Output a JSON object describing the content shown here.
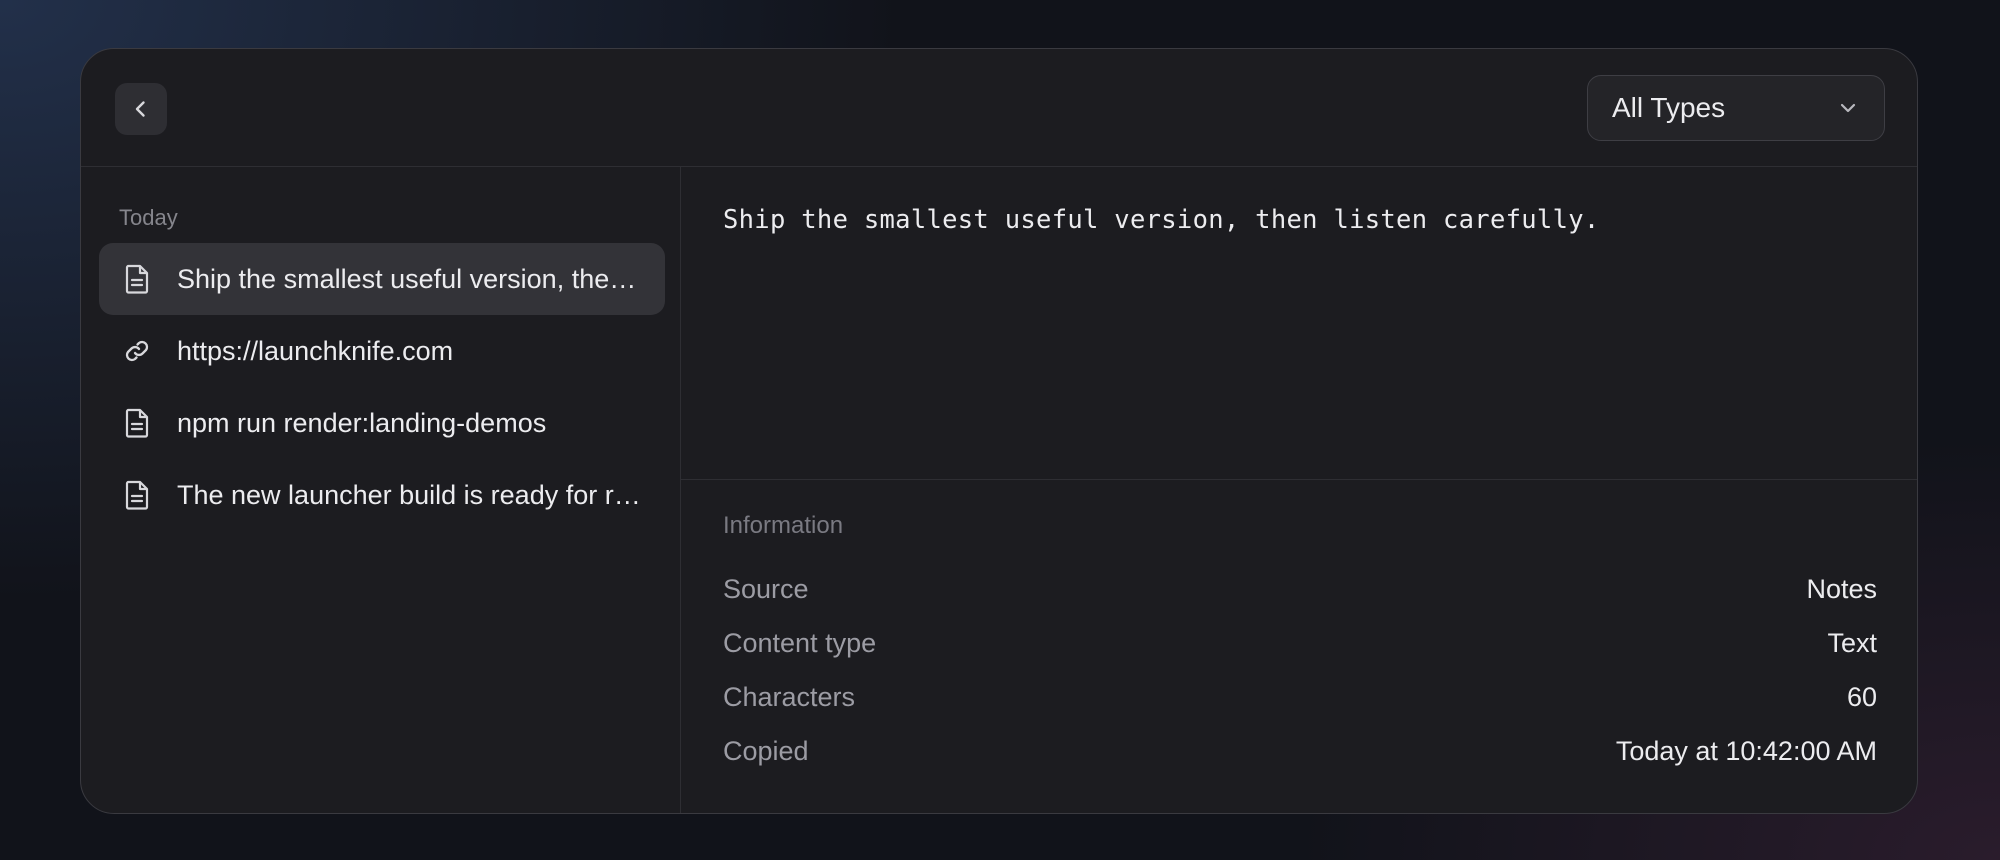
{
  "header": {
    "type_filter": {
      "selected": "All Types"
    }
  },
  "sidebar": {
    "group_label": "Today",
    "items": [
      {
        "icon": "document-icon",
        "label": "Ship the smallest useful version, then listen carefully.",
        "selected": true
      },
      {
        "icon": "link-icon",
        "label": "https://launchknife.com",
        "selected": false
      },
      {
        "icon": "document-icon",
        "label": "npm run render:landing-demos",
        "selected": false
      },
      {
        "icon": "document-icon",
        "label": "The new launcher build is ready for review.",
        "selected": false
      }
    ]
  },
  "preview": {
    "text": "Ship the smallest useful version, then listen carefully."
  },
  "info": {
    "heading": "Information",
    "rows": [
      {
        "key": "Source",
        "value": "Notes"
      },
      {
        "key": "Content type",
        "value": "Text"
      },
      {
        "key": "Characters",
        "value": "60"
      },
      {
        "key": "Copied",
        "value": "Today at 10:42:00 AM"
      }
    ]
  }
}
